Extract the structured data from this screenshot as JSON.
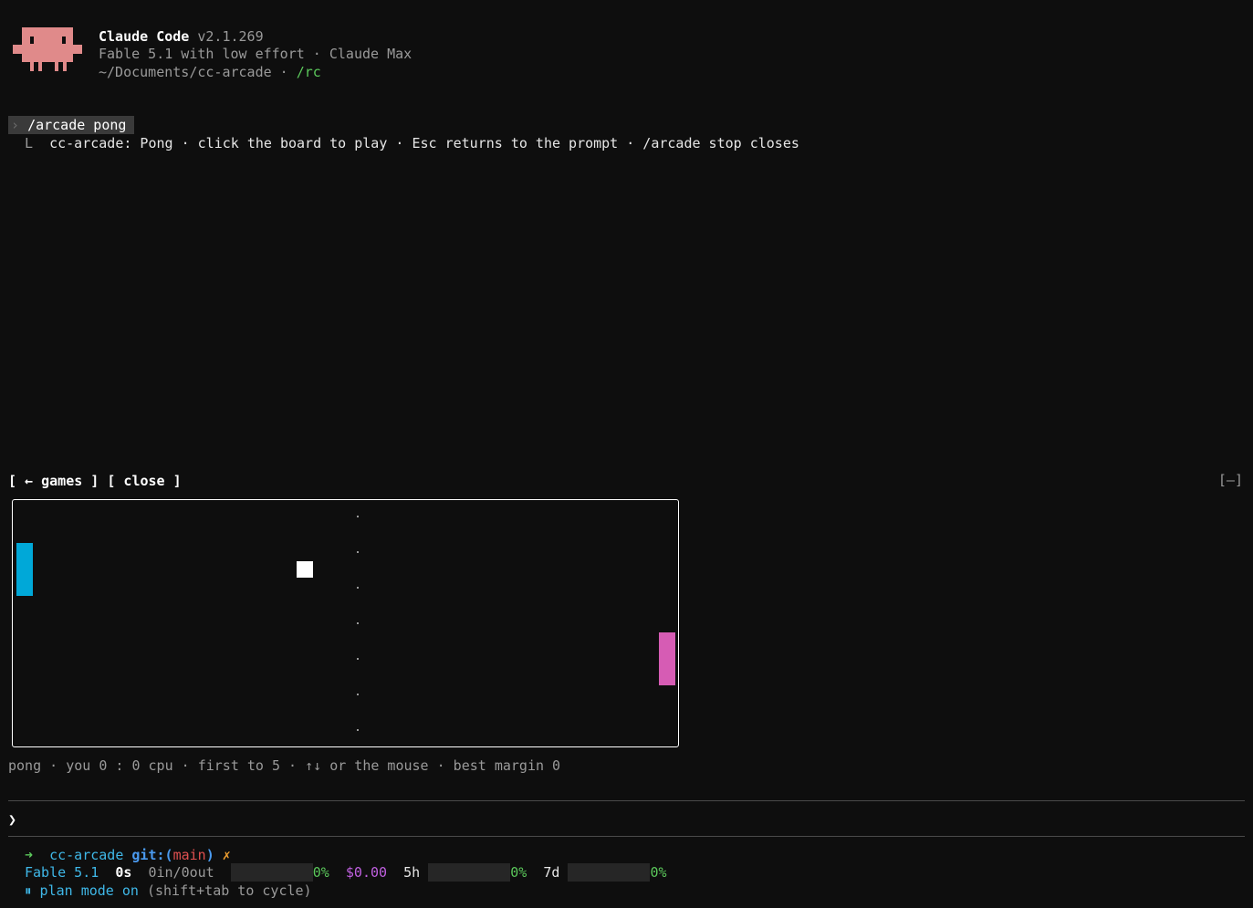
{
  "header": {
    "app_name": "Claude Code",
    "version": "v2.1.269",
    "model_line": "Fable 5.1 with low effort · Claude Max",
    "path": "~/Documents/cc-arcade",
    "sep": " · ",
    "rc": "/rc"
  },
  "command": {
    "chevron": "›",
    "text": "/arcade pong"
  },
  "response": {
    "prefix": "L",
    "text": "cc-arcade: Pong · click the board to play · Esc returns to the prompt · /arcade stop closes"
  },
  "arcade": {
    "games_button": "[ ← games ]",
    "close_button": "[ close ]",
    "minimize_label": "[–]",
    "player_color": "#00a8d8",
    "cpu_color": "#d65cb4",
    "status": "pong · you 0 : 0 cpu · first to 5 · ↑↓ or the mouse · best margin 0"
  },
  "prompt": {
    "chevron": "❯",
    "value": ""
  },
  "statusbar": {
    "arrow": "➜",
    "dir": "cc-arcade",
    "git_label": "git:(",
    "branch": "main",
    "git_close": ")",
    "dirty": "✗",
    "model": "Fable 5.1",
    "time": "0s",
    "tokens": "0in/0out",
    "context_pct": "0%",
    "cost": "$0.00",
    "window_5h_label": "5h",
    "window_5h_pct": "0%",
    "window_7d_label": "7d",
    "window_7d_pct": "0%",
    "plan_icon": "⏸",
    "plan_text": "plan mode on",
    "plan_hint": "(shift+tab to cycle)"
  }
}
